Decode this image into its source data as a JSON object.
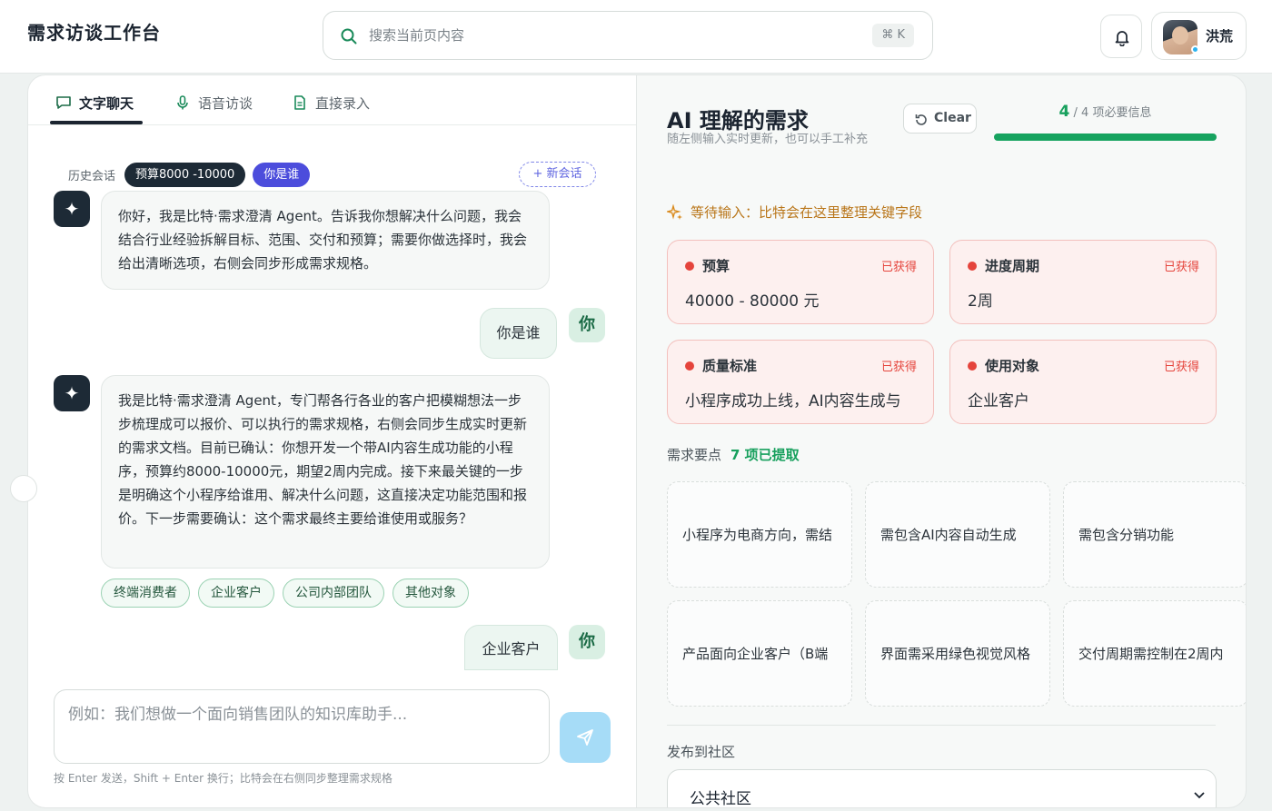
{
  "header": {
    "app_title": "需求访谈工作台",
    "search_placeholder": "搜索当前页内容",
    "search_shortcut": "⌘ K",
    "user_name": "洪荒"
  },
  "tabs": [
    {
      "label": "文字聊天",
      "icon": "chat-icon",
      "active": true
    },
    {
      "label": "语音访谈",
      "icon": "microphone-icon",
      "active": false
    },
    {
      "label": "直接录入",
      "icon": "document-icon",
      "active": false
    }
  ],
  "history": {
    "label": "历史会话",
    "sessions": [
      "预算8000 -10000",
      "你是谁"
    ],
    "new_chat": "+ 新会话"
  },
  "messages": [
    {
      "role": "bot",
      "text": "你好，我是比特·需求澄清 Agent。告诉我你想解决什么问题，我会结合行业经验拆解目标、范围、交付和预算；需要你做选择时，我会给出清晰选项，右侧会同步形成需求规格。"
    },
    {
      "role": "user",
      "text": "你是谁",
      "avatar": "你"
    },
    {
      "role": "bot",
      "text": "我是比特·需求澄清 Agent，专门帮各行各业的客户把模糊想法一步步梳理成可以报价、可以执行的需求规格，右侧会同步生成实时更新的需求文档。目前已确认：你想开发一个带AI内容生成功能的小程序，预算约8000-10000元，期望2周内完成。接下来最关键的一步是明确这个小程序给谁用、解决什么问题，这直接决定功能范围和报价。下一步需要确认：这个需求最终主要给谁使用或服务？"
    },
    {
      "role": "user",
      "text": "企业客户",
      "avatar": "你"
    }
  ],
  "options": [
    "终端消费者",
    "企业客户",
    "公司内部团队",
    "其他对象"
  ],
  "composer": {
    "placeholder": "例如：我们想做一个面向销售团队的知识库助手...",
    "hint": "按 Enter 发送，Shift + Enter 换行；比特会在右侧同步整理需求规格"
  },
  "right": {
    "title": "AI 理解的需求",
    "subtitle": "随左侧输入实时更新，也可以手工补充",
    "clear_label": "Clear",
    "progress": {
      "done": "4",
      "rest": " / 4 项必要信息",
      "fraction": 1.0
    },
    "waiting": "等待输入：比特会在这里整理关键字段",
    "fields": [
      {
        "label": "预算",
        "status": "已获得",
        "value": "40000 - 80000 元"
      },
      {
        "label": "进度周期",
        "status": "已获得",
        "value": "2周"
      },
      {
        "label": "质量标准",
        "status": "已获得",
        "value": "小程序成功上线，AI内容生成与"
      },
      {
        "label": "使用对象",
        "status": "已获得",
        "value": "企业客户"
      }
    ],
    "points_label": "需求要点",
    "points_count": "7 项已提取",
    "points": [
      "小程序为电商方向，需结",
      "需包含AI内容自动生成",
      "需包含分销功能",
      "产品面向企业客户（B端",
      "界面需采用绿色视觉风格",
      "交付周期需控制在2周内"
    ],
    "publish_label": "发布到社区",
    "publish_value": "公共社区"
  },
  "colors": {
    "accent_green": "#16a35f",
    "status_red": "#e5443c",
    "session_purple": "#4c4ddc",
    "dark": "#1d2a36"
  }
}
